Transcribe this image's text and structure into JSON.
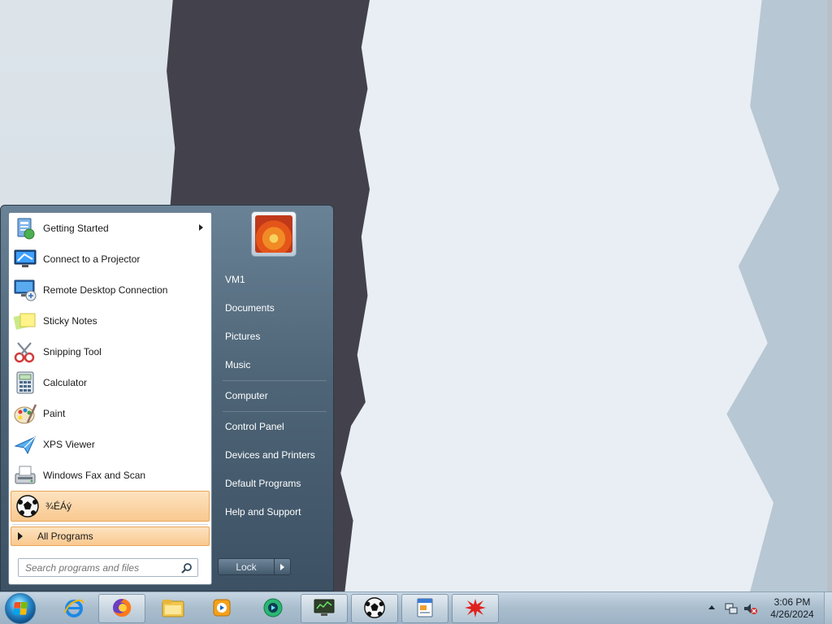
{
  "start_menu": {
    "programs": [
      {
        "label": "Getting Started",
        "icon": "getting-started-icon",
        "has_submenu": true
      },
      {
        "label": "Connect to a Projector",
        "icon": "projector-icon"
      },
      {
        "label": "Remote Desktop Connection",
        "icon": "remote-desktop-icon"
      },
      {
        "label": "Sticky Notes",
        "icon": "sticky-notes-icon"
      },
      {
        "label": "Snipping Tool",
        "icon": "snipping-tool-icon"
      },
      {
        "label": "Calculator",
        "icon": "calculator-icon"
      },
      {
        "label": "Paint",
        "icon": "paint-icon"
      },
      {
        "label": "XPS Viewer",
        "icon": "xps-viewer-icon"
      },
      {
        "label": "Windows Fax and Scan",
        "icon": "fax-scan-icon"
      },
      {
        "label": "¾ÉÁý",
        "icon": "soccer-ball-icon",
        "highlighted": true
      }
    ],
    "all_programs_label": "All Programs",
    "search_placeholder": "Search programs and files",
    "right_items": {
      "user": "VM1",
      "documents": "Documents",
      "pictures": "Pictures",
      "music": "Music",
      "computer": "Computer",
      "control_panel": "Control Panel",
      "devices_printers": "Devices and Printers",
      "default_programs": "Default Programs",
      "help_support": "Help and Support"
    },
    "lock_label": "Lock"
  },
  "taskbar": {
    "pinned": [
      "internet-explorer-icon",
      "firefox-icon",
      "file-explorer-icon",
      "media-player-icon",
      "media-center-icon",
      "monitor-app-icon",
      "soccer-ball-icon",
      "document-app-icon",
      "splat-app-icon"
    ],
    "active": "firefox-icon"
  },
  "tray": {
    "time": "3:06 PM",
    "date": "4/26/2024"
  },
  "colors": {
    "highlight": "#f9c88f",
    "menu_right": "#4e6577",
    "taskbar": "#a9bdcd"
  }
}
